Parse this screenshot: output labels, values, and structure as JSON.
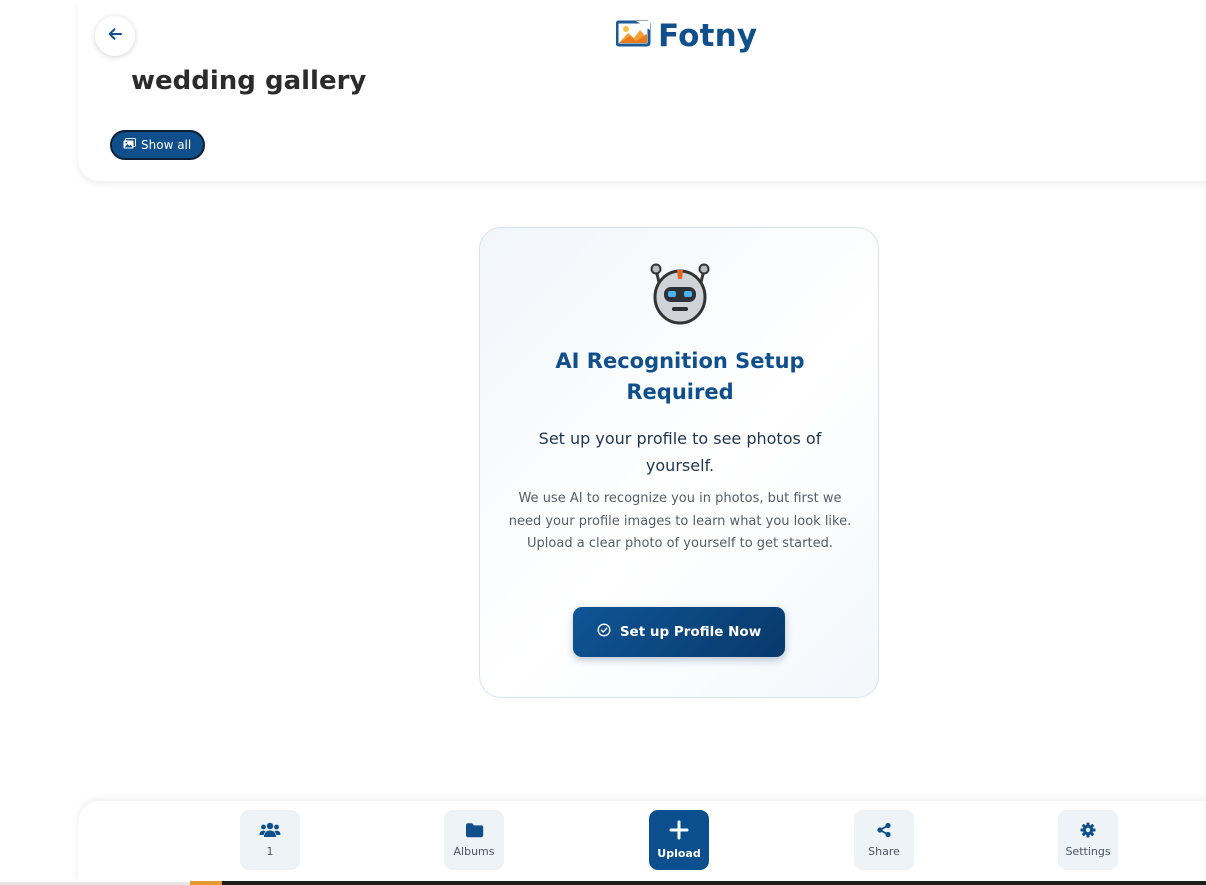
{
  "header": {
    "brand": "Fotny",
    "page_title": "wedding gallery",
    "show_all_label": "Show all"
  },
  "ai_card": {
    "title": "AI Recognition Setup Required",
    "subtitle": "Set up your profile to see photos of yourself.",
    "description": "We use AI to recognize you in photos, but first we need your profile images to learn what you look like. Upload a clear photo of yourself to get started.",
    "button_label": "Set up Profile Now"
  },
  "bottom_nav": {
    "items": [
      {
        "label": "1",
        "icon": "users-icon"
      },
      {
        "label": "Albums",
        "icon": "folder-icon"
      },
      {
        "label": "Upload",
        "icon": "plus-icon"
      },
      {
        "label": "Share",
        "icon": "share-icon"
      },
      {
        "label": "Settings",
        "icon": "gear-icon"
      }
    ]
  },
  "colors": {
    "brand_blue": "#0f4f8c",
    "logo_orange": "#f0a035",
    "card_border": "#d2e4f3"
  }
}
